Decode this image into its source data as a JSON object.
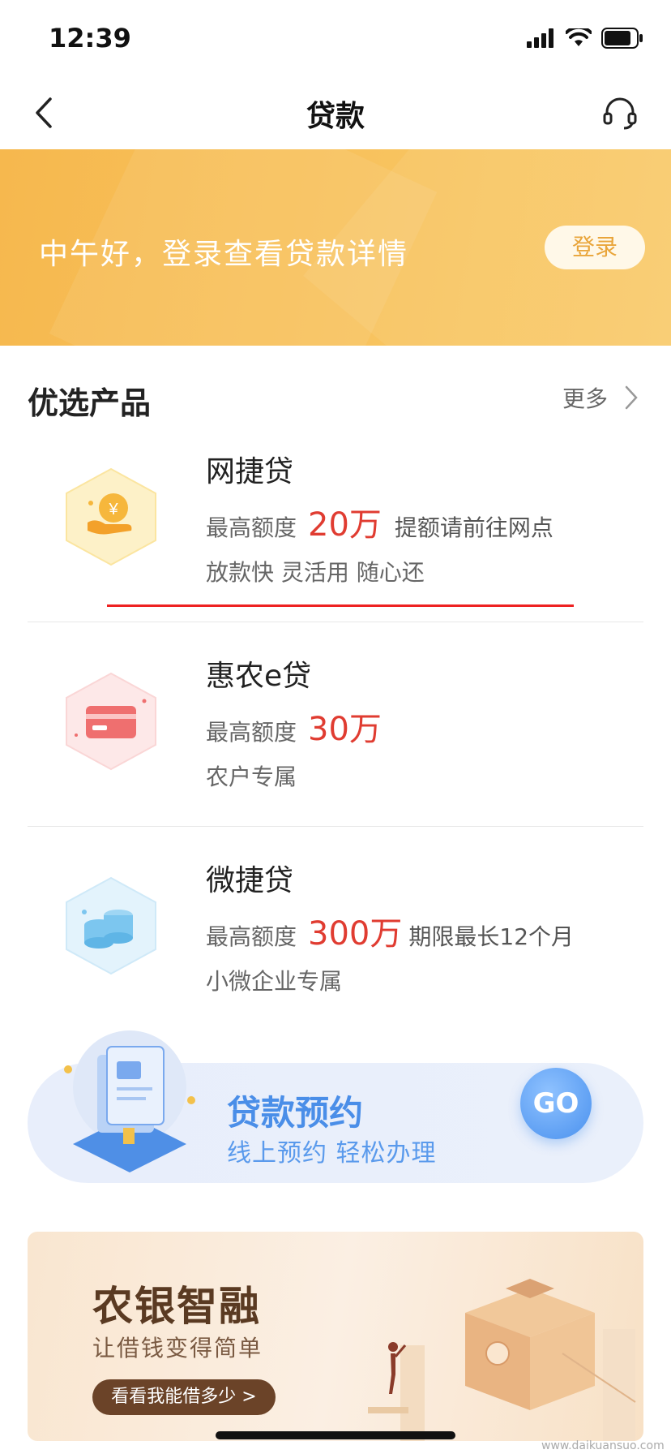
{
  "status_bar": {
    "time": "12:39"
  },
  "nav": {
    "title": "贷款"
  },
  "banner": {
    "greeting": "中午好，登录查看贷款详情",
    "login_label": "登录"
  },
  "section": {
    "title": "优选产品",
    "more_label": "更多"
  },
  "products": [
    {
      "name": "网捷贷",
      "limit_label": "最高额度",
      "amount": "20万",
      "extra": "提额请前往网点",
      "desc": "放款快 灵活用 随心还",
      "icon": "coin-hand-icon",
      "icon_color": "#f5c342"
    },
    {
      "name": "惠农e贷",
      "limit_label": "最高额度",
      "amount": "30万",
      "extra": "",
      "desc": "农户专属",
      "icon": "card-icon",
      "icon_color": "#f07a7a"
    },
    {
      "name": "微捷贷",
      "limit_label": "最高额度",
      "amount": "300万",
      "extra": "期限最长12个月",
      "desc": "小微企业专属",
      "icon": "coins-stack-icon",
      "icon_color": "#7cc6ef"
    }
  ],
  "booking": {
    "title": "贷款预约",
    "subtitle": "线上预约 轻松办理",
    "go_label": "GO"
  },
  "ad": {
    "headline": "农银智融",
    "subline": "让借钱变得简单",
    "button_label": "看看我能借多少 >"
  },
  "watermark": "www.daikuansuo.com",
  "colors": {
    "accent_red": "#e03c31",
    "banner": "#f8c15b",
    "booking_blue": "#4a8ee8"
  }
}
